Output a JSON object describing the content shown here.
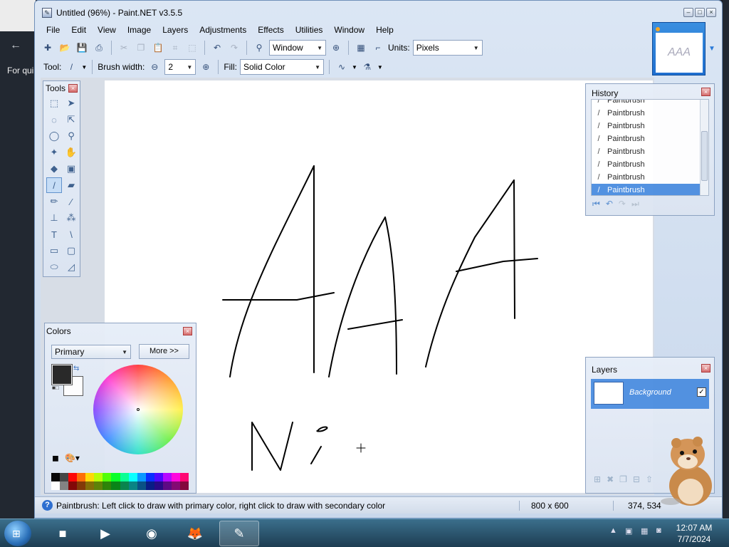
{
  "desktop": {
    "back_glyph": "←",
    "side_text": "For qui"
  },
  "window": {
    "title": "Untitled (96%) - Paint.NET v3.5.5",
    "app_icon_glyph": "✎",
    "buttons": {
      "min": "–",
      "max": "□",
      "close": "×"
    }
  },
  "menu": [
    "File",
    "Edit",
    "View",
    "Image",
    "Layers",
    "Adjustments",
    "Effects",
    "Utilities",
    "Window",
    "Help"
  ],
  "toolbar": {
    "zoom_value": "Window",
    "units_label": "Units:",
    "units_value": "Pixels",
    "tool_label": "Tool:",
    "brush_width_label": "Brush width:",
    "brush_width_value": "2",
    "fill_label": "Fill:",
    "fill_value": "Solid Color",
    "icons": [
      "new-icon",
      "open-icon",
      "save-icon",
      "print-icon",
      "cut-icon",
      "copy-icon",
      "paste-icon",
      "crop-icon",
      "deselect-icon",
      "undo-icon",
      "redo-icon",
      "zoom-icon",
      "zoom-in-icon",
      "grid-icon",
      "ruler-icon"
    ]
  },
  "thumbnail": {
    "preview_text": "AAA"
  },
  "tools_panel": {
    "title": "Tools",
    "tools": [
      {
        "name": "rectangle-select-icon",
        "glyph": "⬚"
      },
      {
        "name": "move-selection-icon",
        "glyph": "➤"
      },
      {
        "name": "lasso-select-icon",
        "glyph": "◌"
      },
      {
        "name": "move-selected-icon",
        "glyph": "⇱"
      },
      {
        "name": "ellipse-select-icon",
        "glyph": "◯"
      },
      {
        "name": "zoom-tool-icon",
        "glyph": "⚲"
      },
      {
        "name": "magic-wand-icon",
        "glyph": "✦"
      },
      {
        "name": "pan-icon",
        "glyph": "✋"
      },
      {
        "name": "paint-bucket-icon",
        "glyph": "◆"
      },
      {
        "name": "gradient-icon",
        "glyph": "▣"
      },
      {
        "name": "paintbrush-icon",
        "glyph": "/",
        "active": true
      },
      {
        "name": "eraser-icon",
        "glyph": "▰"
      },
      {
        "name": "pencil-icon",
        "glyph": "✏"
      },
      {
        "name": "color-picker-icon",
        "glyph": "⁄"
      },
      {
        "name": "clone-stamp-icon",
        "glyph": "⊥"
      },
      {
        "name": "recolor-icon",
        "glyph": "⁂"
      },
      {
        "name": "text-icon",
        "glyph": "T"
      },
      {
        "name": "line-curve-icon",
        "glyph": "\\"
      },
      {
        "name": "rectangle-icon",
        "glyph": "▭"
      },
      {
        "name": "rounded-rectangle-icon",
        "glyph": "▢"
      },
      {
        "name": "ellipse-icon",
        "glyph": "⬭"
      },
      {
        "name": "freeform-shape-icon",
        "glyph": "◿"
      }
    ]
  },
  "history_panel": {
    "title": "History",
    "items": [
      "Paintbrush",
      "Paintbrush",
      "Paintbrush",
      "Paintbrush",
      "Paintbrush",
      "Paintbrush",
      "Paintbrush",
      "Paintbrush"
    ],
    "selected_index": 7
  },
  "colors_panel": {
    "title": "Colors",
    "mode_value": "Primary",
    "more_label": "More >>",
    "primary_color": "#222222",
    "secondary_color": "#ffffff",
    "palette_top": [
      "#000000",
      "#404040",
      "#ff0000",
      "#ff6a00",
      "#ffd800",
      "#b6ff00",
      "#4cff00",
      "#00ff21",
      "#00ff90",
      "#00ffff",
      "#0094ff",
      "#0026ff",
      "#4800ff",
      "#b200ff",
      "#ff00dc",
      "#ff006e"
    ],
    "palette_bottom": [
      "#ffffff",
      "#808080",
      "#7f0000",
      "#7f3300",
      "#7f6a00",
      "#5b7f00",
      "#267f00",
      "#007f0e",
      "#007f46",
      "#007f7f",
      "#004a7f",
      "#00137f",
      "#21007f",
      "#57007f",
      "#7f006e",
      "#7f0037"
    ]
  },
  "layers_panel": {
    "title": "Layers",
    "layer_name": "Background",
    "check": "✓"
  },
  "status": {
    "icon": "?",
    "text": "Paintbrush: Left click to draw with primary color, right click to draw with secondary color",
    "image_size": "800 x 600",
    "cursor_pos": "374, 534"
  },
  "taskbar": {
    "start_glyph": "⊞",
    "apps": [
      {
        "name": "taskbar-app-terminal",
        "glyph": "■"
      },
      {
        "name": "taskbar-app-media-player",
        "glyph": "▶"
      },
      {
        "name": "taskbar-app-globe",
        "glyph": "◉"
      },
      {
        "name": "taskbar-app-firefox",
        "glyph": "🦊"
      },
      {
        "name": "taskbar-app-paint-net",
        "glyph": "✎",
        "active": true
      }
    ],
    "time": "12:07 AM",
    "date": "7/7/2024"
  }
}
